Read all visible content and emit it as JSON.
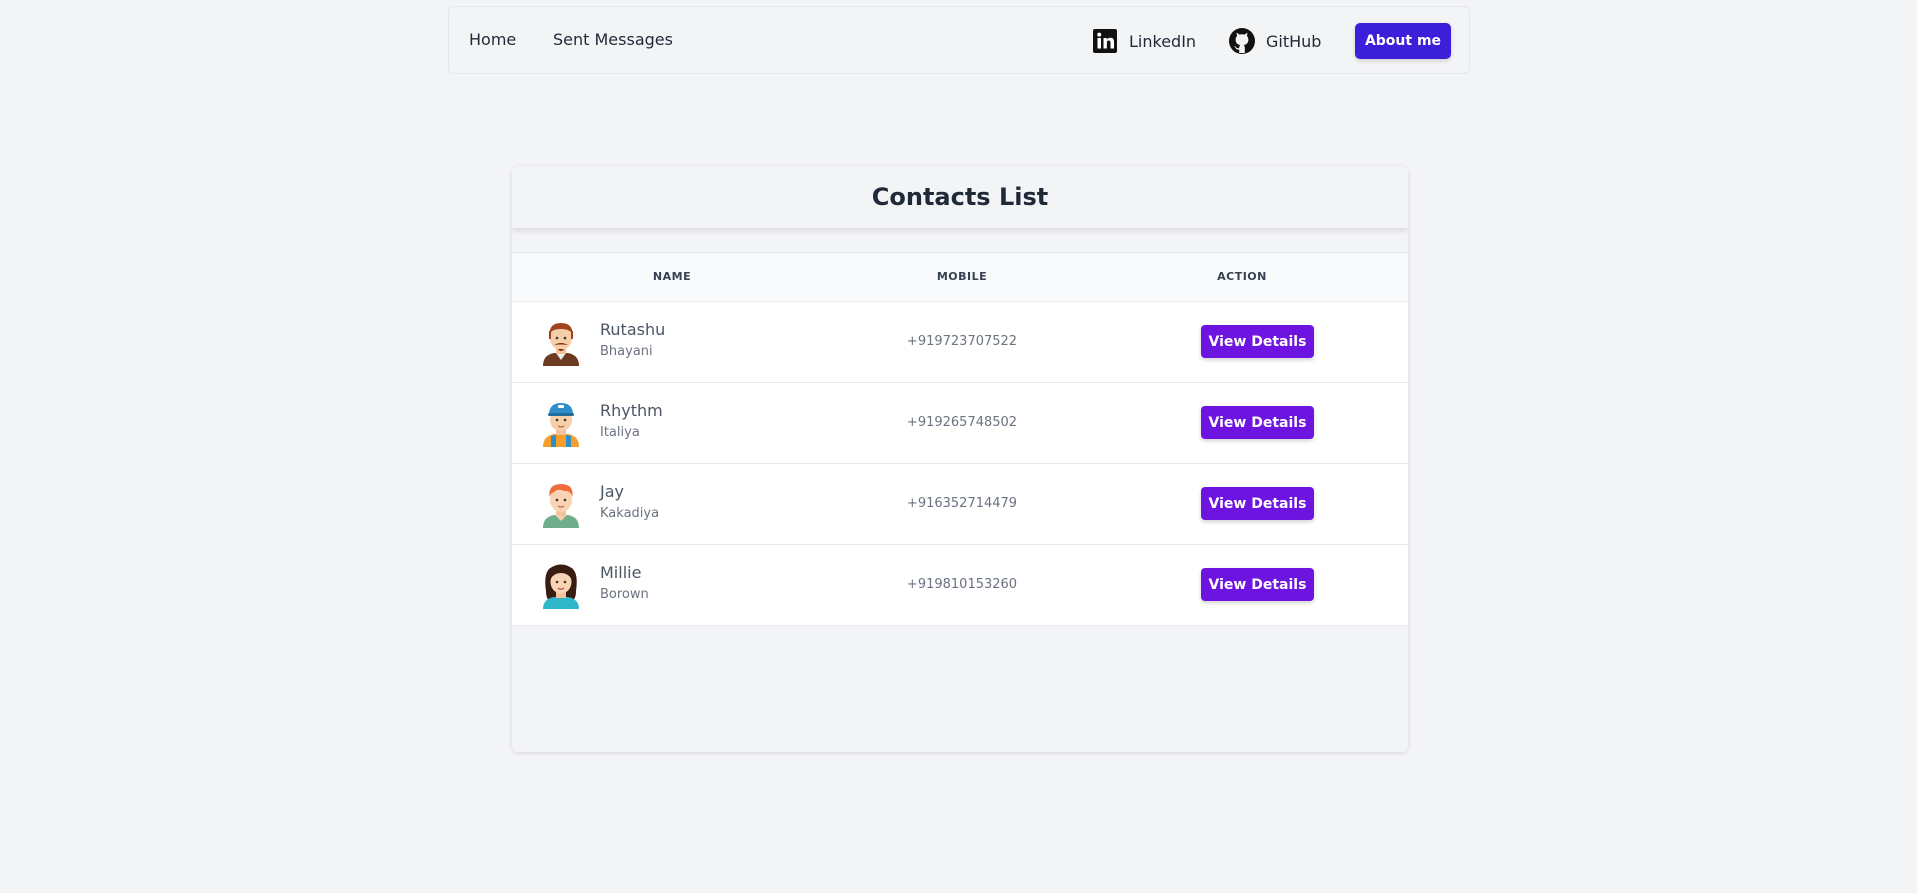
{
  "nav": {
    "home": "Home",
    "sent_messages": "Sent Messages",
    "linkedin": "LinkedIn",
    "github": "GitHub",
    "about": "About me"
  },
  "contacts": {
    "title": "Contacts List",
    "columns": [
      "NAME",
      "MOBILE",
      "ACTION"
    ],
    "action_label": "View Details",
    "rows": [
      {
        "first": "Rutashu",
        "last": "Bhayani",
        "mobile": "+919723707522",
        "avatar": "man-mustache-avatar-icon"
      },
      {
        "first": "Rhythm",
        "last": "Italiya",
        "mobile": "+919265748502",
        "avatar": "man-cap-avatar-icon"
      },
      {
        "first": "Jay",
        "last": "Kakadiya",
        "mobile": "+916352714479",
        "avatar": "man-ginger-avatar-icon"
      },
      {
        "first": "Millie",
        "last": "Borown",
        "mobile": "+919810153260",
        "avatar": "woman-avatar-icon"
      }
    ]
  },
  "colors": {
    "about_button": "#3b1fd9",
    "view_button": "#6d14e0",
    "background": "#f3f4f6"
  }
}
